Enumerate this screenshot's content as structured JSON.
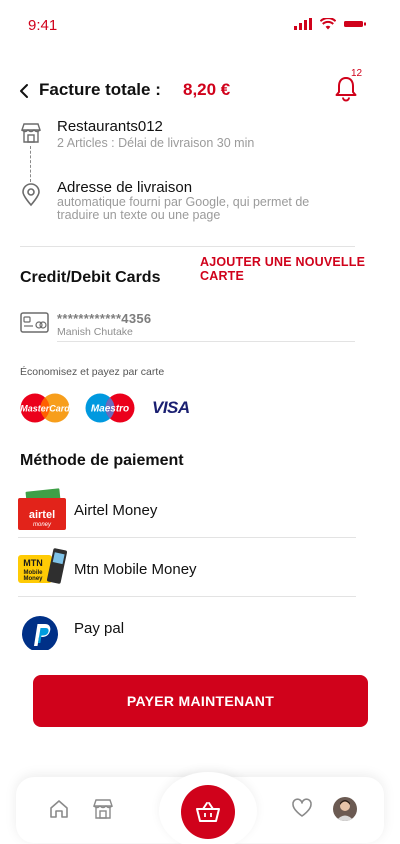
{
  "status_bar": {
    "time": "9:41"
  },
  "header": {
    "title": "Facture totale :",
    "amount": "8,20 €",
    "notification_count": "12"
  },
  "order": {
    "restaurant_name": "Restaurants012",
    "restaurant_details": "2 Articles : Délai de livraison 30 min",
    "address_title": "Adresse de livraison",
    "address_description": "automatique fourni par Google, qui permet de traduire un texte ou une page"
  },
  "cards": {
    "title": "Credit/Debit Cards",
    "add_card_label": "AJOUTER UNE NOUVELLE CARTE",
    "saved_card": {
      "number": "************4356",
      "holder": "Manish Chutake"
    },
    "save_text": "Économisez et payez par carte",
    "brands": {
      "mastercard": "MasterCard",
      "maestro": "Maestro",
      "visa": "VISA"
    }
  },
  "payment_methods": {
    "title": "Méthode de paiement",
    "items": [
      {
        "label": "Airtel Money",
        "icon": "airtel-money-logo"
      },
      {
        "label": "Mtn Mobile Money",
        "icon": "mtn-mobile-money-logo"
      },
      {
        "label": "Pay pal",
        "icon": "paypal-logo"
      }
    ],
    "logo_text": {
      "airtel": "airtel",
      "airtel_sub": "money",
      "mtn": "MTN",
      "mtn_sub_1": "Mobile",
      "mtn_sub_2": "Money"
    }
  },
  "pay_button_label": "PAYER MAINTENANT",
  "colors": {
    "accent": "#d0021b",
    "text": "#111111",
    "muted": "#9b9b9b"
  },
  "bottom_nav": {
    "items": [
      "home-icon",
      "store-icon",
      "basket-icon",
      "heart-icon",
      "avatar"
    ]
  }
}
